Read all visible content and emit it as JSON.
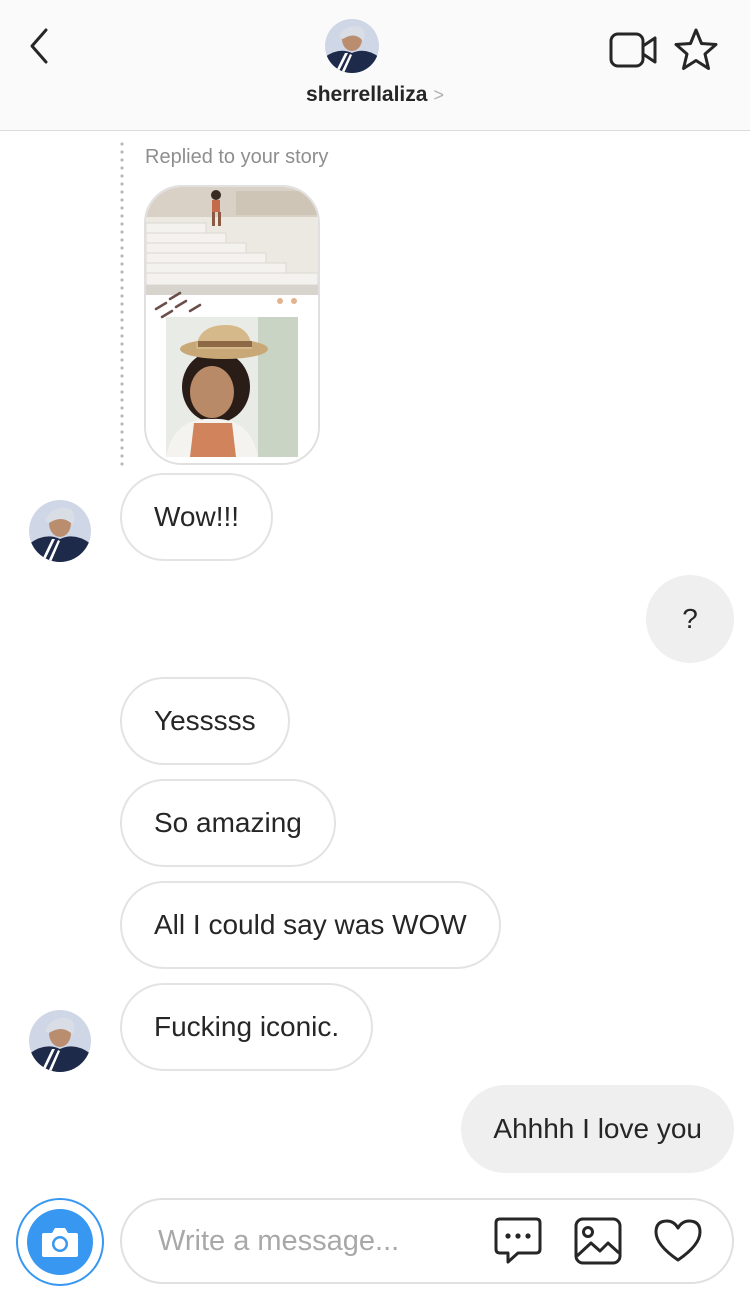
{
  "header": {
    "username": "sherrellaliza",
    "chevron": ">",
    "icons": [
      "back-chevron-icon",
      "video-call-icon",
      "star-icon"
    ]
  },
  "story_reply": {
    "caption": "Replied to your story"
  },
  "messages": [
    {
      "side": "in",
      "text": "Wow!!!"
    },
    {
      "side": "out",
      "text": "?"
    },
    {
      "side": "in",
      "text": "Yesssss"
    },
    {
      "side": "in",
      "text": "So amazing"
    },
    {
      "side": "in",
      "text": "All I could say was WOW"
    },
    {
      "side": "in",
      "text": "Fucking iconic."
    },
    {
      "side": "out",
      "text": "Ahhhh I love you"
    }
  ],
  "composer": {
    "placeholder": "Write a message...",
    "icons": [
      "camera-icon",
      "chat-bubble-icon",
      "image-icon",
      "heart-icon"
    ]
  },
  "colors": {
    "accent": "#3897f0",
    "incoming_border": "#e3e3e3",
    "outgoing_bg": "#efefef",
    "header_bg": "#fafafa"
  }
}
